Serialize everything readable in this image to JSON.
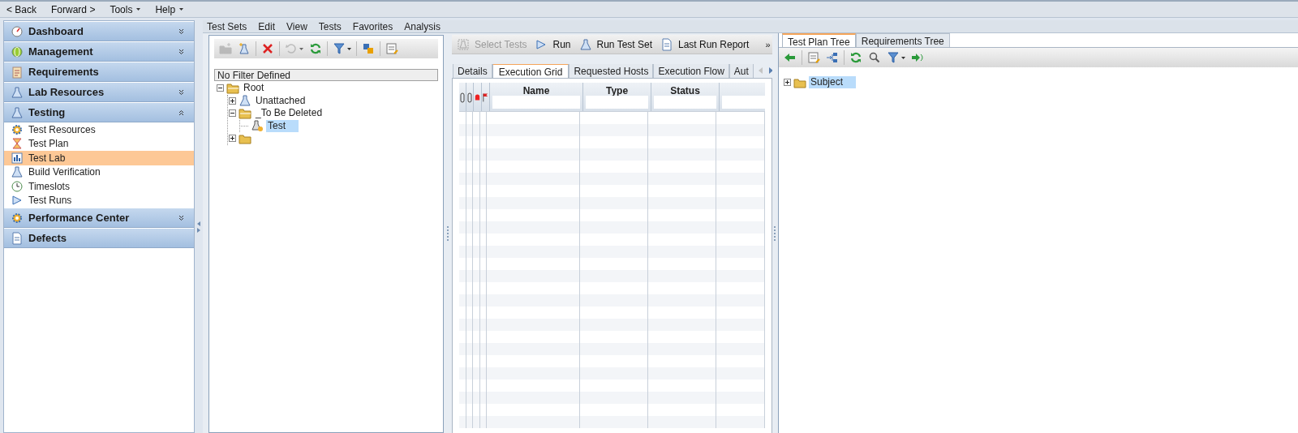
{
  "top_menu": [
    {
      "label": "< Back",
      "has_menu": false
    },
    {
      "label": "Forward >",
      "has_menu": false
    },
    {
      "label": "Tools",
      "has_menu": true
    },
    {
      "label": "Help",
      "has_menu": true
    }
  ],
  "sidebar": {
    "modules": [
      {
        "label": "Dashboard",
        "kind": "gauge",
        "expanded": false
      },
      {
        "label": "Management",
        "kind": "globe",
        "expanded": false
      },
      {
        "label": "Requirements",
        "kind": "clipboard"
      },
      {
        "label": "Lab Resources",
        "kind": "flask",
        "expanded": false
      },
      {
        "label": "Testing",
        "kind": "flask",
        "expanded": true,
        "items": [
          {
            "label": "Test Resources",
            "kind": "gear",
            "selected": false
          },
          {
            "label": "Test Plan",
            "kind": "hourglass",
            "selected": false
          },
          {
            "label": "Test Lab",
            "kind": "chart",
            "selected": true
          },
          {
            "label": "Build Verification",
            "kind": "flask",
            "selected": false
          },
          {
            "label": "Timeslots",
            "kind": "clock",
            "selected": false
          },
          {
            "label": "Test Runs",
            "kind": "play",
            "selected": false
          }
        ]
      },
      {
        "label": "Performance Center",
        "kind": "gear",
        "expanded": false
      },
      {
        "label": "Defects",
        "kind": "doc"
      }
    ]
  },
  "main_menu": [
    "Test Sets",
    "Edit",
    "View",
    "Tests",
    "Favorites",
    "Analysis"
  ],
  "test_sets_panel": {
    "toolbar": [
      {
        "kind": "new-folder",
        "disabled": true
      },
      {
        "kind": "new-test-set",
        "disabled": false
      },
      {
        "kind": "delete",
        "disabled": false
      },
      {
        "kind": "reset",
        "disabled": true
      },
      {
        "kind": "refresh",
        "disabled": false
      },
      {
        "kind": "filter",
        "disabled": false
      },
      {
        "kind": "sync",
        "disabled": false
      },
      {
        "kind": "notes",
        "disabled": false
      }
    ],
    "filter_label": "No Filter Defined",
    "tree": [
      {
        "label": "Root",
        "kind": "folder-open",
        "expanded": true,
        "selected": false,
        "children": [
          {
            "label": "Unattached",
            "kind": "flask",
            "expanded": false,
            "selected": false
          },
          {
            "label": "_To Be Deleted",
            "kind": "folder-open",
            "expanded": true,
            "selected": false,
            "children": [
              {
                "label": "Test",
                "kind": "test-set",
                "selected": true
              }
            ]
          },
          {
            "kind": "folder",
            "expanded": false,
            "selected": false
          }
        ]
      }
    ]
  },
  "execution_panel": {
    "toolbar": [
      {
        "label": "Select Tests",
        "kind": "select",
        "disabled": true
      },
      {
        "label": "Run",
        "kind": "play",
        "disabled": false
      },
      {
        "label": "Run Test Set",
        "kind": "flask",
        "disabled": false
      },
      {
        "label": "Last Run Report",
        "kind": "doc",
        "disabled": false
      }
    ],
    "overflow": "»",
    "tabs": [
      {
        "label": "Details",
        "selected": false
      },
      {
        "label": "Execution Grid",
        "selected": true
      },
      {
        "label": "Requested Hosts",
        "selected": false
      },
      {
        "label": "Execution Flow",
        "selected": false
      },
      {
        "label": "Aut",
        "selected": false
      }
    ],
    "grid": {
      "icon_columns": [
        {
          "kind": "attachment"
        },
        {
          "kind": "attachment"
        },
        {
          "kind": "alert"
        },
        {
          "kind": "flag"
        }
      ],
      "columns": [
        {
          "label": "Name"
        },
        {
          "label": "Type"
        },
        {
          "label": "Status"
        },
        {}
      ]
    }
  },
  "plan_panel": {
    "tabs": [
      {
        "label": "Test Plan Tree",
        "selected": true
      },
      {
        "label": "Requirements Tree",
        "selected": false
      }
    ],
    "toolbar": [
      {
        "kind": "back"
      },
      {
        "kind": "notes"
      },
      {
        "kind": "hierarchy"
      },
      {
        "kind": "refresh"
      },
      {
        "kind": "search"
      },
      {
        "kind": "filter"
      },
      {
        "kind": "goto"
      }
    ],
    "tree": [
      {
        "label": "Subject",
        "kind": "folder",
        "expanded": false,
        "selected": true
      }
    ]
  }
}
